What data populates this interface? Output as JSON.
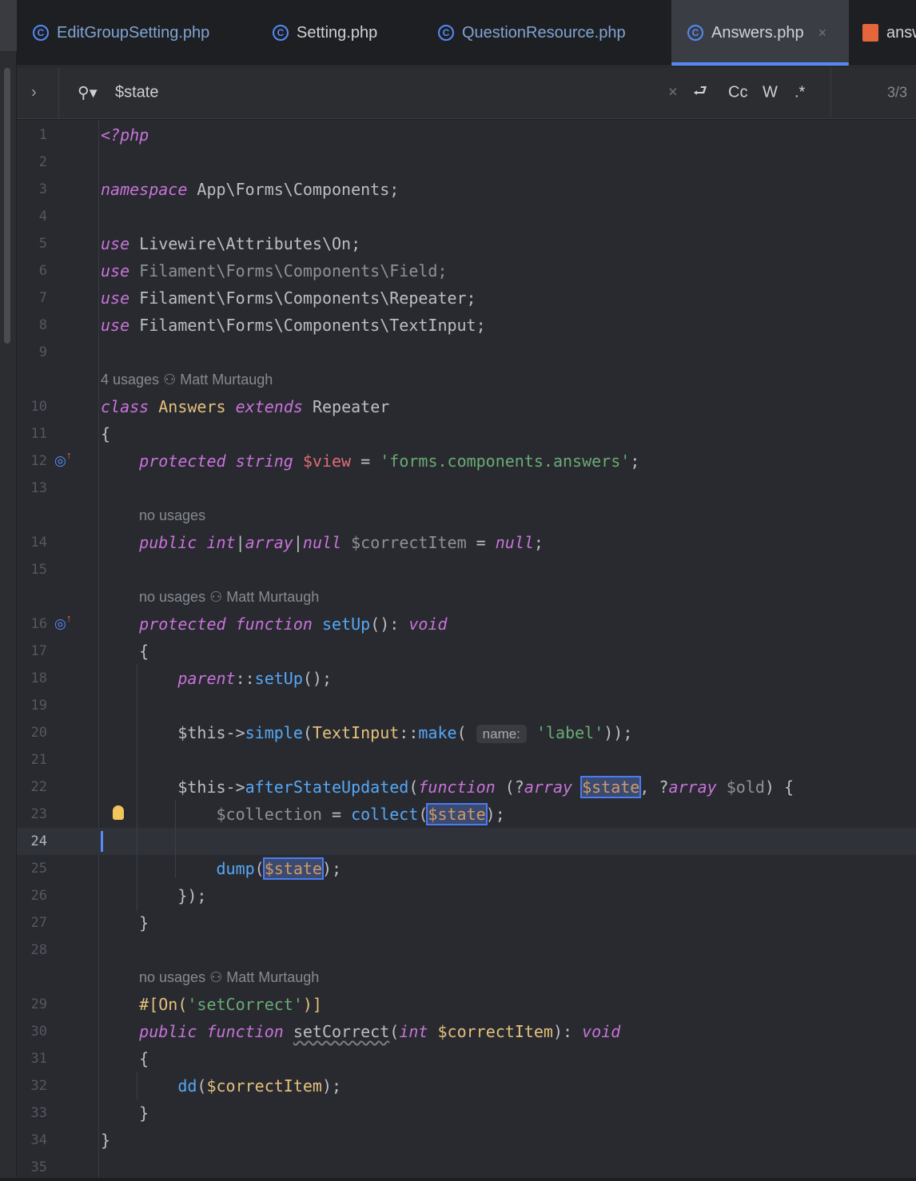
{
  "tabs": [
    {
      "label": "EditGroupSetting.php",
      "icon": "class-icon"
    },
    {
      "label": "Setting.php",
      "icon": "class-icon"
    },
    {
      "label": "QuestionResource.php",
      "icon": "class-icon"
    },
    {
      "label": "Answers.php",
      "icon": "class-icon",
      "active": true,
      "close": "×"
    },
    {
      "label": "answ",
      "icon": "laravel-icon"
    }
  ],
  "search": {
    "query": "$state",
    "clear": "×",
    "case": "Cc",
    "words": "W",
    "regex": ".*",
    "count": "3/3"
  },
  "hints": {
    "h1": "4 usages",
    "author": "Matt Murtaugh",
    "none": "no usages"
  },
  "param_hint": "name:",
  "lines": [
    [
      [
        "kw",
        "<?php"
      ]
    ],
    [],
    [
      [
        "kw",
        "namespace"
      ],
      [
        "t",
        " App\\Forms\\Components;"
      ]
    ],
    [],
    [
      [
        "kw",
        "use"
      ],
      [
        "t",
        " Livewire\\Attributes\\On;"
      ]
    ],
    [
      [
        "kw",
        "use"
      ],
      [
        "muted",
        " Filament\\Forms\\Components\\Field;"
      ]
    ],
    [
      [
        "kw",
        "use"
      ],
      [
        "t",
        " Filament\\Forms\\Components\\Repeater;"
      ]
    ],
    [
      [
        "kw",
        "use"
      ],
      [
        "t",
        " Filament\\Forms\\Components\\TextInput;"
      ]
    ],
    [],
    [
      [
        "kw",
        "class"
      ],
      [
        "t",
        " "
      ],
      [
        "cls",
        "Answers"
      ],
      [
        "t",
        " "
      ],
      [
        "kw",
        "extends"
      ],
      [
        "t",
        " Repeater"
      ]
    ],
    [
      [
        "t",
        "{"
      ]
    ],
    [
      [
        "t",
        "    "
      ],
      [
        "kw",
        "protected"
      ],
      [
        "t",
        " "
      ],
      [
        "kw",
        "string"
      ],
      [
        "t",
        " "
      ],
      [
        "vr",
        "$view"
      ],
      [
        "t",
        " = "
      ],
      [
        "str",
        "'forms.components.answers'"
      ],
      [
        "t",
        ";"
      ]
    ],
    [],
    [
      [
        "t",
        "    "
      ],
      [
        "kw",
        "public"
      ],
      [
        "t",
        " "
      ],
      [
        "kw",
        "int"
      ],
      [
        "t",
        "|"
      ],
      [
        "kw",
        "array"
      ],
      [
        "t",
        "|"
      ],
      [
        "kw",
        "null"
      ],
      [
        "t",
        " "
      ],
      [
        "muted",
        "$correctItem"
      ],
      [
        "t",
        " = "
      ],
      [
        "kw",
        "null"
      ],
      [
        "t",
        ";"
      ]
    ],
    [],
    [
      [
        "t",
        "    "
      ],
      [
        "kw",
        "protected"
      ],
      [
        "t",
        " "
      ],
      [
        "kw",
        "function"
      ],
      [
        "t",
        " "
      ],
      [
        "fn",
        "setUp"
      ],
      [
        "t",
        "(): "
      ],
      [
        "kw",
        "void"
      ]
    ],
    [
      [
        "t",
        "    {"
      ]
    ],
    [
      [
        "t",
        "        "
      ],
      [
        "kw",
        "parent"
      ],
      [
        "t",
        "::"
      ],
      [
        "fn",
        "setUp"
      ],
      [
        "t",
        "();"
      ]
    ],
    [],
    [
      [
        "t",
        "        $this->"
      ],
      [
        "fn",
        "simple"
      ],
      [
        "t",
        "("
      ],
      [
        "cls",
        "TextInput"
      ],
      [
        "t",
        "::"
      ],
      [
        "fn",
        "make"
      ],
      [
        "t",
        "( "
      ],
      [
        "param",
        "name:"
      ],
      [
        "t",
        " "
      ],
      [
        "str",
        "'label'"
      ],
      [
        "t",
        "));"
      ]
    ],
    [],
    [
      [
        "t",
        "        $this->"
      ],
      [
        "fn",
        "afterStateUpdated"
      ],
      [
        "t",
        "("
      ],
      [
        "kw",
        "function"
      ],
      [
        "t",
        " (?"
      ],
      [
        "kw",
        "array"
      ],
      [
        "t",
        " "
      ],
      [
        "st",
        "$state"
      ],
      [
        "t",
        ", ?"
      ],
      [
        "kw",
        "array"
      ],
      [
        "t",
        " "
      ],
      [
        "muted",
        "$old"
      ],
      [
        "t",
        ") {"
      ]
    ],
    [
      [
        "t",
        "            "
      ],
      [
        "muted",
        "$collection"
      ],
      [
        "t",
        " = "
      ],
      [
        "fn",
        "collect"
      ],
      [
        "t",
        "("
      ],
      [
        "st",
        "$state"
      ],
      [
        "t",
        ");"
      ]
    ],
    [],
    [
      [
        "t",
        "            "
      ],
      [
        "fn",
        "dump"
      ],
      [
        "t",
        "("
      ],
      [
        "st",
        "$state"
      ],
      [
        "t",
        ");"
      ]
    ],
    [
      [
        "t",
        "        });"
      ]
    ],
    [
      [
        "t",
        "    }"
      ]
    ],
    [],
    [
      [
        "t",
        "    "
      ],
      [
        "attr",
        "#[On("
      ],
      [
        "str",
        "'setCorrect'"
      ],
      [
        "attr",
        ")]"
      ]
    ],
    [
      [
        "t",
        "    "
      ],
      [
        "kw",
        "public"
      ],
      [
        "t",
        " "
      ],
      [
        "kw",
        "function"
      ],
      [
        "t",
        " "
      ],
      [
        "squig",
        "setCorrect"
      ],
      [
        "t",
        "("
      ],
      [
        "kw",
        "int"
      ],
      [
        "t",
        " "
      ],
      [
        "cls",
        "$correctItem"
      ],
      [
        "t",
        "): "
      ],
      [
        "kw",
        "void"
      ]
    ],
    [
      [
        "t",
        "    {"
      ]
    ],
    [
      [
        "t",
        "        "
      ],
      [
        "fn",
        "dd"
      ],
      [
        "t",
        "("
      ],
      [
        "cls",
        "$correctItem"
      ],
      [
        "t",
        ");"
      ]
    ],
    [
      [
        "t",
        "    }"
      ]
    ],
    [
      [
        "t",
        "}"
      ]
    ],
    []
  ]
}
